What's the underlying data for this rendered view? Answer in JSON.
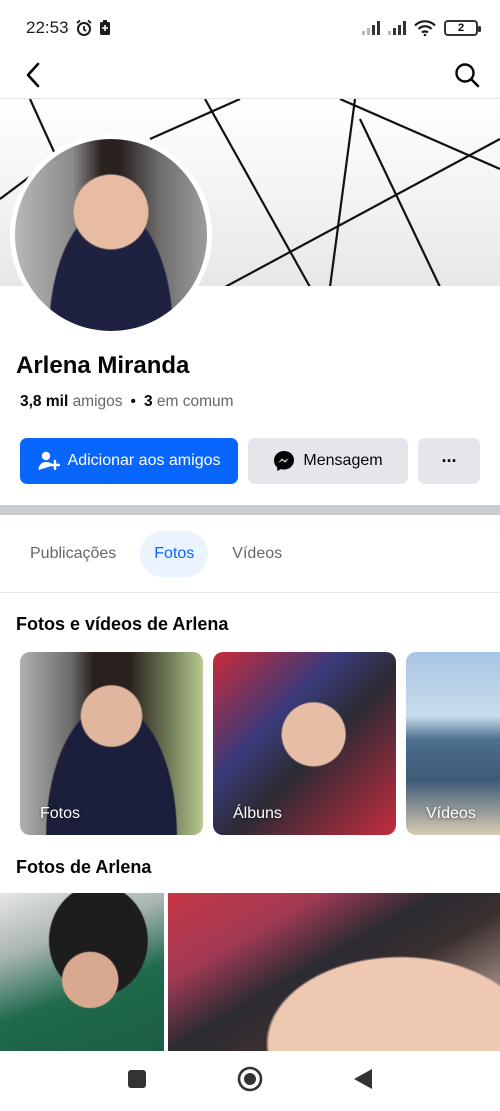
{
  "status_bar": {
    "time": "22:53",
    "battery": "2",
    "icons": [
      "alarm-icon",
      "battery-saver-icon",
      "signal-icon",
      "signal-icon",
      "wifi-icon",
      "battery-icon"
    ]
  },
  "top_nav": {
    "back_icon": "chevron-left-icon",
    "search_icon": "search-icon"
  },
  "profile": {
    "name": "Arlena Miranda",
    "friends_count": "3,8 mil",
    "friends_label": "amigos",
    "separator": "•",
    "mutual_count": "3",
    "mutual_label": "em comum"
  },
  "actions": {
    "add_friend": "Adicionar aos amigos",
    "message": "Mensagem",
    "more": "···"
  },
  "tabs": [
    {
      "label": "Publicações",
      "active": false
    },
    {
      "label": "Fotos",
      "active": true
    },
    {
      "label": "Vídeos",
      "active": false
    }
  ],
  "media_section": {
    "title": "Fotos e vídeos de Arlena",
    "cards": [
      {
        "label": "Fotos"
      },
      {
        "label": "Álbuns"
      },
      {
        "label": "Vídeos"
      }
    ]
  },
  "photos_section": {
    "title": "Fotos de Arlena"
  },
  "colors": {
    "accent": "#0866ff",
    "secondary_button": "#e4e6eb",
    "active_tab_bg": "#ebf3ff",
    "muted_text": "#65676b"
  }
}
